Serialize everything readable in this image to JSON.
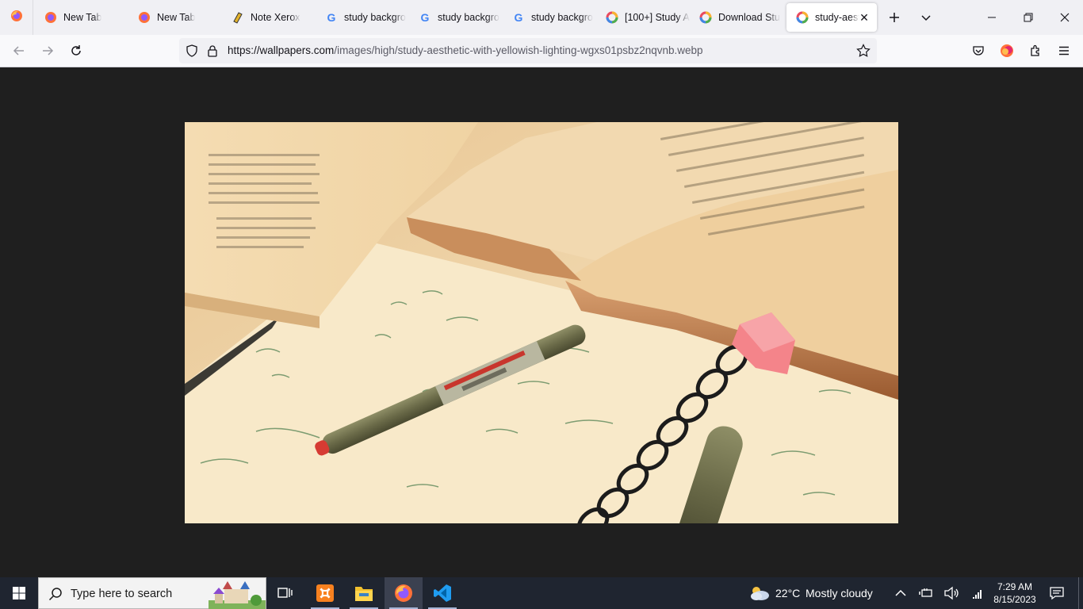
{
  "browser": {
    "tabs": [
      {
        "label": "New Tab",
        "icon": "firefox-icon"
      },
      {
        "label": "New Tab",
        "icon": "firefox-icon"
      },
      {
        "label": "Note Xerox",
        "icon": "note-xerox-icon"
      },
      {
        "label": "study backgro",
        "icon": "google-icon"
      },
      {
        "label": "study backgro",
        "icon": "google-icon"
      },
      {
        "label": "study backgro",
        "icon": "google-icon"
      },
      {
        "label": "[100+] Study A",
        "icon": "wallpapers-icon"
      },
      {
        "label": "Download Stu",
        "icon": "wallpapers-icon"
      },
      {
        "label": "study-aesth",
        "icon": "wallpapers-icon",
        "active": true
      }
    ],
    "url_host": "https://wallpapers.com",
    "url_path": "/images/high/study-aesthetic-with-yellowish-lighting-wgxs01psbz2nqvnb.webp"
  },
  "taskbar": {
    "search_placeholder": "Type here to search",
    "weather_temp": "22°C",
    "weather_desc": "Mostly cloudy",
    "time": "7:29 AM",
    "date": "8/15/2023"
  },
  "colors": {
    "accent": "#0060df",
    "taskbar_bg": "#1f2530",
    "page_bg": "#1f1f1f"
  }
}
